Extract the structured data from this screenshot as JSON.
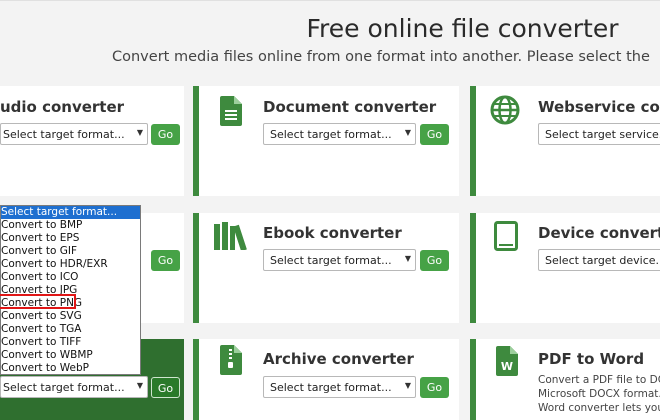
{
  "page": {
    "title": "Free online file converter",
    "subtitle": "Convert media files online from one format into another. Please select the"
  },
  "cards": {
    "audio": {
      "title": "udio converter",
      "select_label": "Select target format...",
      "go": "Go"
    },
    "document": {
      "title": "Document converter",
      "select_label": "Select target format...",
      "go": "Go"
    },
    "webservice": {
      "title": "Webservice conve",
      "select_label": "Select target service..."
    },
    "image": {
      "go": "Go"
    },
    "ebook": {
      "title": "Ebook converter",
      "select_label": "Select target format...",
      "go": "Go"
    },
    "device": {
      "title": "Device converter",
      "select_label": "Select target device..."
    },
    "video": {
      "select_label": "Select target format...",
      "go": "Go"
    },
    "archive": {
      "title": "Archive converter",
      "select_label": "Select target format...",
      "go": "Go"
    },
    "pdf_to_word": {
      "title": "PDF to Word",
      "desc": [
        "Convert a PDF file to DOC",
        "Microsoft DOCX format. Y",
        "Word converter lets you"
      ]
    }
  },
  "dropdown": {
    "items": [
      "Select target format...",
      "Convert to BMP",
      "Convert to EPS",
      "Convert to GIF",
      "Convert to HDR/EXR",
      "Convert to ICO",
      "Convert to JPG",
      "Convert to PNG",
      "Convert to SVG",
      "Convert to TGA",
      "Convert to TIFF",
      "Convert to WBMP",
      "Convert to WebP"
    ]
  },
  "colors": {
    "accent_green": "#3e8a3e",
    "button_green": "#46a246",
    "selection_blue": "#1e6fd0",
    "highlight_red": "#e01616"
  }
}
